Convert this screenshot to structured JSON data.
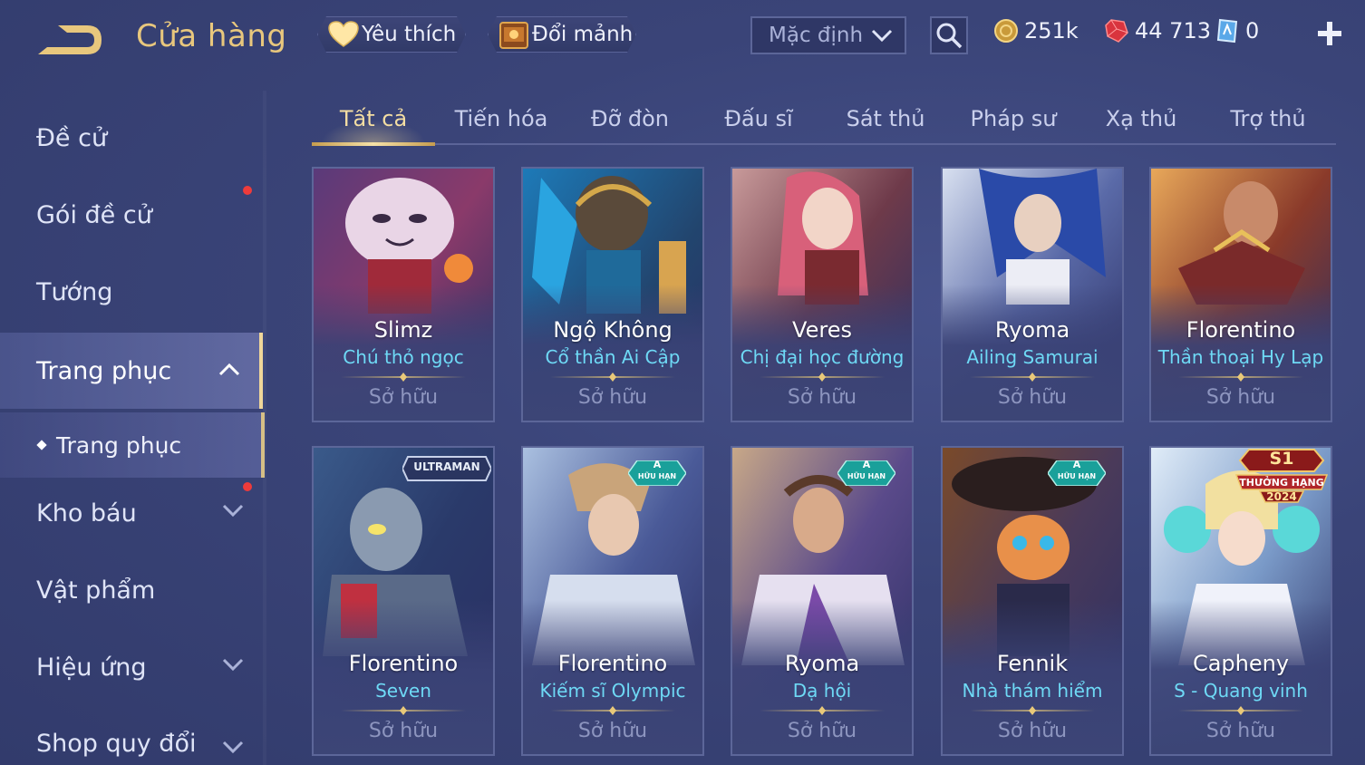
{
  "header": {
    "title": "Cửa hàng",
    "favorite_label": "Yêu thích",
    "trade_label": "Đổi mảnh",
    "sort_value": "Mặc định",
    "gold": "251k",
    "ruby": "44 713",
    "voucher": "0"
  },
  "sidebar": {
    "items": [
      {
        "label": "Đề cử"
      },
      {
        "label": "Gói đề cử"
      },
      {
        "label": "Tướng"
      },
      {
        "label": "Trang phục"
      },
      {
        "label": "Trang phục"
      },
      {
        "label": "Kho báu"
      },
      {
        "label": "Vật phẩm"
      },
      {
        "label": "Hiệu ứng"
      },
      {
        "label": "Shop quy đổi"
      }
    ]
  },
  "tabs": [
    {
      "label": "Tất cả"
    },
    {
      "label": "Tiến hóa"
    },
    {
      "label": "Đỡ đòn"
    },
    {
      "label": "Đấu sĩ"
    },
    {
      "label": "Sát thủ"
    },
    {
      "label": "Pháp sư"
    },
    {
      "label": "Xạ thủ"
    },
    {
      "label": "Trợ thủ"
    }
  ],
  "cards": [
    {
      "hero": "Slimz",
      "skin": "Chú thỏ ngọc",
      "status": "Sở hữu"
    },
    {
      "hero": "Ngộ Không",
      "skin": "Cổ thần Ai Cập",
      "status": "Sở hữu"
    },
    {
      "hero": "Veres",
      "skin": "Chị đại học đường",
      "status": "Sở hữu"
    },
    {
      "hero": "Ryoma",
      "skin": "Ailing Samurai",
      "status": "Sở hữu"
    },
    {
      "hero": "Florentino",
      "skin": "Thần thoại Hy Lạp",
      "status": "Sở hữu"
    },
    {
      "hero": "Florentino",
      "skin": "Seven",
      "status": "Sở hữu",
      "badge": "ULTRAMAN"
    },
    {
      "hero": "Florentino",
      "skin": "Kiếm sĩ Olympic",
      "status": "Sở hữu",
      "badge_top": "A",
      "badge_bottom": "HỮU HẠN"
    },
    {
      "hero": "Ryoma",
      "skin": "Dạ hội",
      "status": "Sở hữu",
      "badge_top": "A",
      "badge_bottom": "HỮU HẠN"
    },
    {
      "hero": "Fennik",
      "skin": "Nhà thám hiểm",
      "status": "Sở hữu",
      "badge_top": "A",
      "badge_bottom": "HỮU HẠN"
    },
    {
      "hero": "Capheny",
      "skin": "S - Quang vinh",
      "status": "Sở hữu",
      "badge_top": "S1",
      "badge_mid": "THƯỞNG HẠNG",
      "badge_bottom": "2024"
    }
  ],
  "colors": {
    "accent_gold": "#e8c77d",
    "skin_name_cyan": "#6ed9f5",
    "background": "#3a4478",
    "notification_red": "#ee3b3b"
  },
  "icons": [
    "back-arrow-icon",
    "heart-icon",
    "chest-icon",
    "chevron-down-icon",
    "search-icon",
    "gold-coin-icon",
    "ruby-gem-icon",
    "voucher-icon",
    "plus-icon",
    "chevron-up-icon"
  ]
}
